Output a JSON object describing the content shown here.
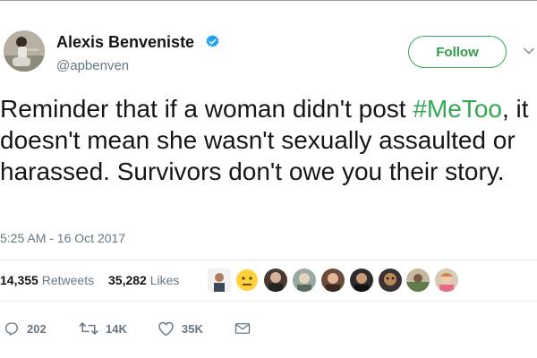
{
  "tweet": {
    "author_name": "Alexis Benveniste",
    "handle": "@apbenven",
    "follow_label": "Follow",
    "text_before": "Reminder that if a woman didn't post ",
    "hashtag": "#MeToo",
    "text_after": ", it doesn't mean she wasn't sexually assaulted or harassed. Survivors don't owe you their story.",
    "timestamp": "5:25 AM - 16 Oct 2017"
  },
  "stats": {
    "retweets_count": "14,355",
    "retweets_label": "Retweets",
    "likes_count": "35,282",
    "likes_label": "Likes"
  },
  "actions": {
    "reply_count": "202",
    "retweet_count": "14K",
    "like_count": "35K"
  },
  "colors": {
    "follow_green": "#34a853",
    "hashtag_green": "#33a852",
    "verified_blue": "#1da1f2",
    "muted_gray": "#657786"
  }
}
